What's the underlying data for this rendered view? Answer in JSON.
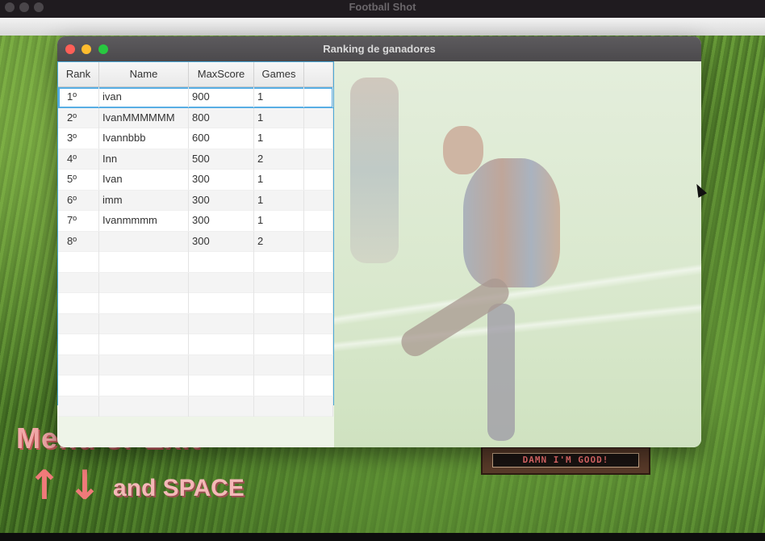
{
  "outer_window": {
    "title": "Football Shot"
  },
  "game": {
    "menu_text": "Menu or Exit",
    "arrow_up": "↑",
    "arrow_down": "↓",
    "controls_text": "and SPACE",
    "banner_text": "DAMN I'M GOOD!"
  },
  "ranking_window": {
    "title": "Ranking de ganadores",
    "columns": [
      "Rank",
      "Name",
      "MaxScore",
      "Games"
    ],
    "rows": [
      {
        "rank": "1º",
        "name": "ivan",
        "max_score": "900",
        "games": "1"
      },
      {
        "rank": "2º",
        "name": "IvanMMMMMM",
        "max_score": "800",
        "games": "1"
      },
      {
        "rank": "3º",
        "name": "Ivannbbb",
        "max_score": "600",
        "games": "1"
      },
      {
        "rank": "4º",
        "name": "Inn",
        "max_score": "500",
        "games": "2"
      },
      {
        "rank": "5º",
        "name": "Ivan",
        "max_score": "300",
        "games": "1"
      },
      {
        "rank": "6º",
        "name": "imm",
        "max_score": "300",
        "games": "1"
      },
      {
        "rank": "7º",
        "name": "Ivanmmmm",
        "max_score": "300",
        "games": "1"
      },
      {
        "rank": "8º",
        "name": "",
        "max_score": "300",
        "games": "2"
      }
    ],
    "selected_row": 0
  }
}
